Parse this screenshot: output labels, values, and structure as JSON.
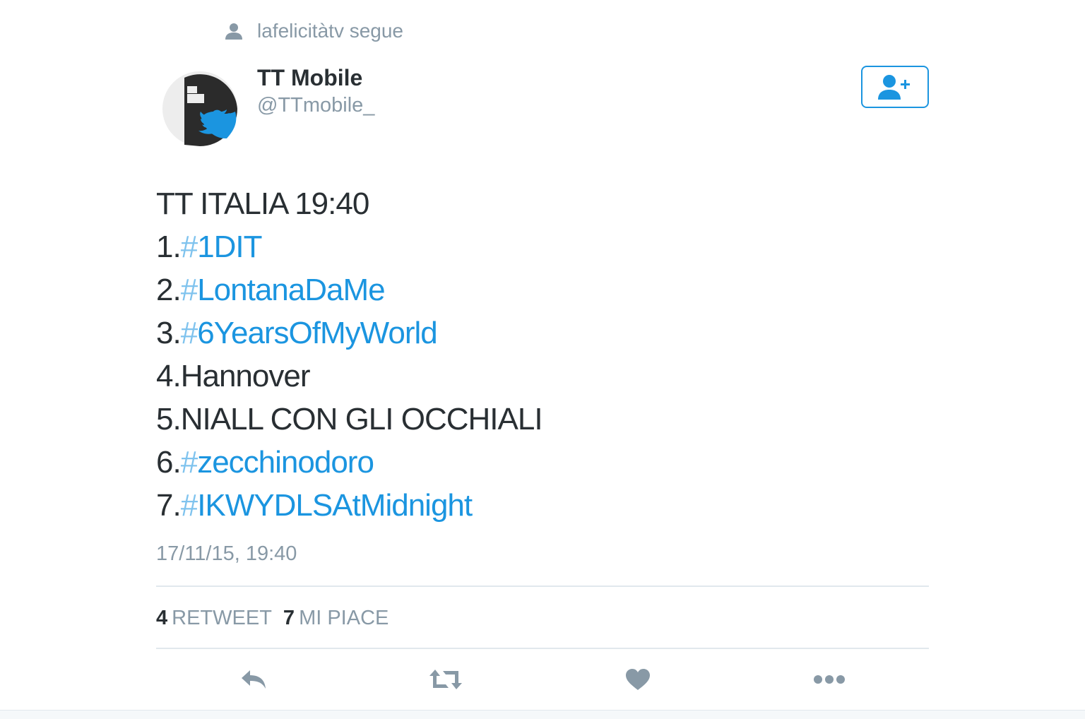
{
  "social_context": {
    "icon": "person-icon",
    "text": "lafelicitàtv segue"
  },
  "author": {
    "display_name": "TT Mobile",
    "handle": "@TTmobile_",
    "avatar": "tt-mobile-logo"
  },
  "follow_button": {
    "icon": "follow-user-plus-icon",
    "color": "#1b95e0"
  },
  "tweet": {
    "lines": [
      {
        "prefix": "TT ITALIA 19:40",
        "hashtag": ""
      },
      {
        "prefix": "1.",
        "hashtag": "1DIT"
      },
      {
        "prefix": "2.",
        "hashtag": "LontanaDaMe"
      },
      {
        "prefix": "3.",
        "hashtag": "6YearsOfMyWorld"
      },
      {
        "prefix": "4.Hannover",
        "hashtag": ""
      },
      {
        "prefix": "5.NIALL CON GLI OCCHIALI",
        "hashtag": ""
      },
      {
        "prefix": "6.",
        "hashtag": "zecchinodoro"
      },
      {
        "prefix": "7.",
        "hashtag": "IKWYDLSAtMidnight"
      }
    ],
    "timestamp": "17/11/15, 19:40"
  },
  "stats": {
    "retweets_count": "4",
    "retweets_label": "RETWEET",
    "likes_count": "7",
    "likes_label": "MI PIACE"
  },
  "actions": {
    "reply_icon": "reply-icon",
    "retweet_icon": "retweet-icon",
    "like_icon": "heart-icon",
    "more_icon": "more-dots-icon"
  },
  "colors": {
    "link": "#1b95e0",
    "text": "#292f33",
    "muted": "#8899a6",
    "divider": "#e1e8ed"
  }
}
